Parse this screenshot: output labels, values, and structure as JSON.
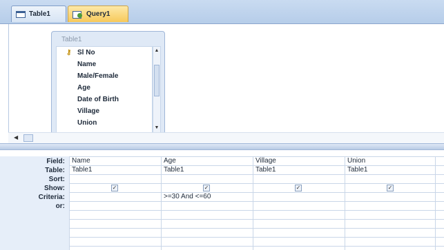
{
  "tabs": [
    {
      "label": "Table1",
      "icon": "table-icon",
      "active": false
    },
    {
      "label": "Query1",
      "icon": "query-icon",
      "active": true
    }
  ],
  "field_list": {
    "title": "Table1",
    "fields": [
      "Sl No",
      "Name",
      "Male/Female",
      "Age",
      "Date of Birth",
      "Village",
      "Union"
    ]
  },
  "grid": {
    "row_labels": [
      "Field:",
      "Table:",
      "Sort:",
      "Show:",
      "Criteria:",
      "or:"
    ],
    "columns": [
      {
        "field": "Name",
        "table": "Table1",
        "show": true,
        "criteria": ""
      },
      {
        "field": "Age",
        "table": "Table1",
        "show": true,
        "criteria": ">=30 And <=60"
      },
      {
        "field": "Village",
        "table": "Table1",
        "show": true,
        "criteria": ""
      },
      {
        "field": "Union",
        "table": "Table1",
        "show": true,
        "criteria": ""
      }
    ]
  },
  "colors": {
    "tab_active": "#f7c95a",
    "tab_bar": "#c9dbf1",
    "grid_line": "#c9d6e8"
  }
}
